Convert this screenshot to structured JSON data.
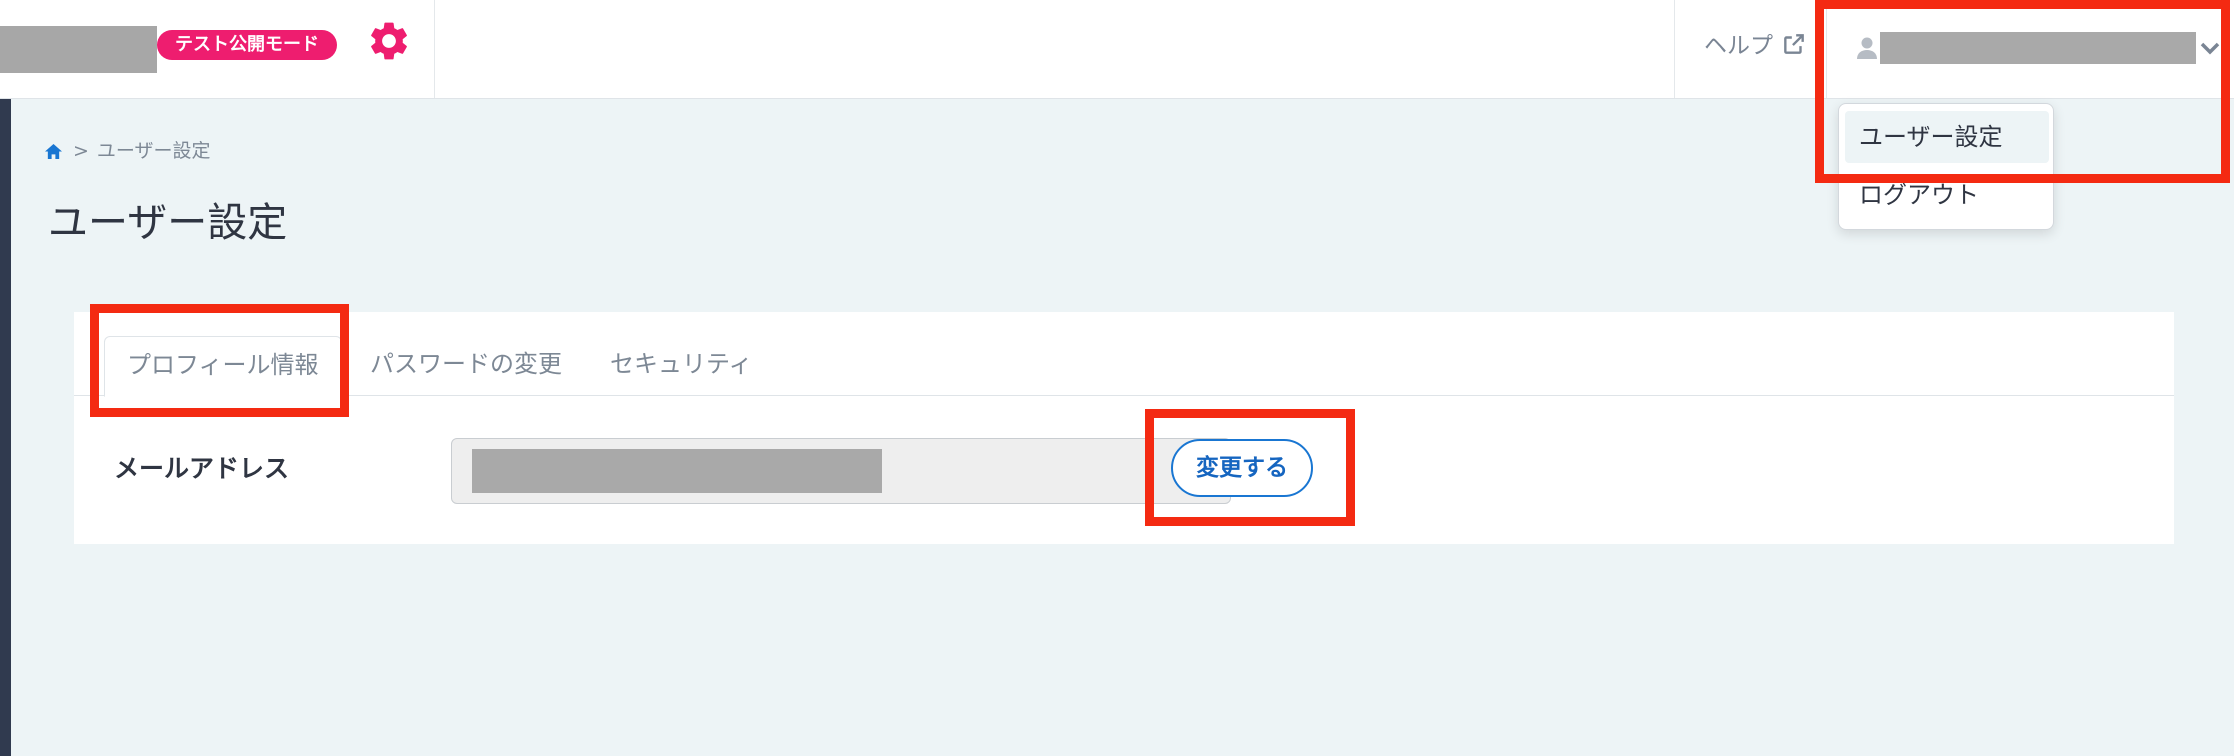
{
  "header": {
    "mode_badge": "テスト公開モード",
    "settings_icon": "gear-icon",
    "help_label": "ヘルプ",
    "help_icon": "external-link-icon",
    "user_icon": "user-icon",
    "chevron_icon": "chevron-down-icon"
  },
  "dropdown": {
    "items": [
      {
        "label": "ユーザー設定",
        "active": true
      },
      {
        "label": "ログアウト",
        "active": false
      }
    ]
  },
  "breadcrumb": {
    "home_icon": "home-icon",
    "separator": ">",
    "current": "ユーザー設定"
  },
  "page": {
    "title": "ユーザー設定"
  },
  "tabs": [
    {
      "label": "プロフィール情報",
      "active": true
    },
    {
      "label": "パスワードの変更",
      "active": false
    },
    {
      "label": "セキュリティ",
      "active": false
    }
  ],
  "profile": {
    "email_label": "メールアドレス",
    "change_button": "変更する"
  },
  "colors": {
    "badge": "#ee1d6f",
    "gear": "#ee1d6f",
    "accent": "#1976d2",
    "annotation": "#f42a12",
    "background": "#edf4f6"
  }
}
